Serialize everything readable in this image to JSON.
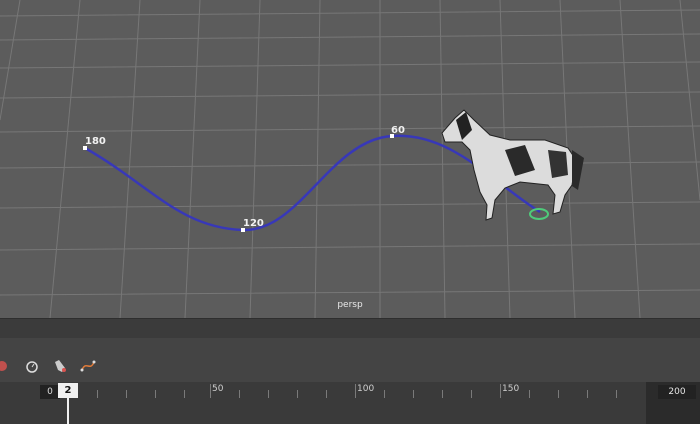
{
  "viewport": {
    "camera_label": "persp",
    "path_labels": [
      "180",
      "120",
      "60"
    ]
  },
  "toolbar": {
    "icons": [
      "key-icon",
      "stopwatch-icon",
      "horse-select-icon",
      "motion-path-icon"
    ]
  },
  "timeline": {
    "start_frame": "0",
    "current_frame": "2",
    "end_frame": "200",
    "ruler_labels": [
      "50",
      "100",
      "150"
    ]
  }
}
